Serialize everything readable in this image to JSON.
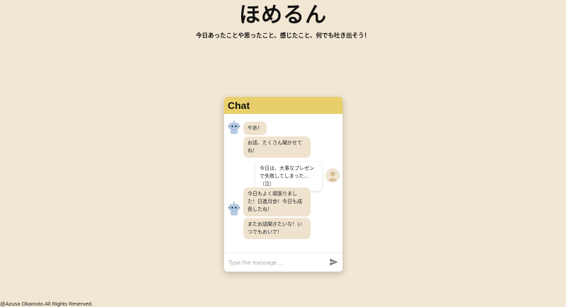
{
  "app": {
    "title": "ほめるん",
    "subtitle": "今日あったことや思ったこと、感じたこと、何でも吐き出そう！"
  },
  "chat": {
    "header": "Chat",
    "messages": [
      {
        "sender": "bot",
        "text": "やあ！"
      },
      {
        "sender": "bot",
        "text": "お話、たくさん聞かせてね！"
      },
      {
        "sender": "user",
        "text": "今日は、大事なプレゼンで失敗してしまった...（泣）"
      },
      {
        "sender": "bot",
        "text": "今日もよく頑張りました！日進月歩！今日も成長したね！"
      },
      {
        "sender": "bot",
        "text": "またお話聞きたいな！いつでもおいで！"
      }
    ],
    "input_placeholder": "Type the message ...",
    "send_icon": "send-icon",
    "bot_avatar_icon": "robot-icon",
    "user_avatar_icon": "person-icon"
  },
  "footer": {
    "copyright": "@Azusa Okamoto.All Rights Reserved."
  },
  "colors": {
    "background": "#f2e7d4",
    "header": "#e8cf6b",
    "bot_bubble": "#efe3cf",
    "user_bubble": "#ffffff"
  }
}
